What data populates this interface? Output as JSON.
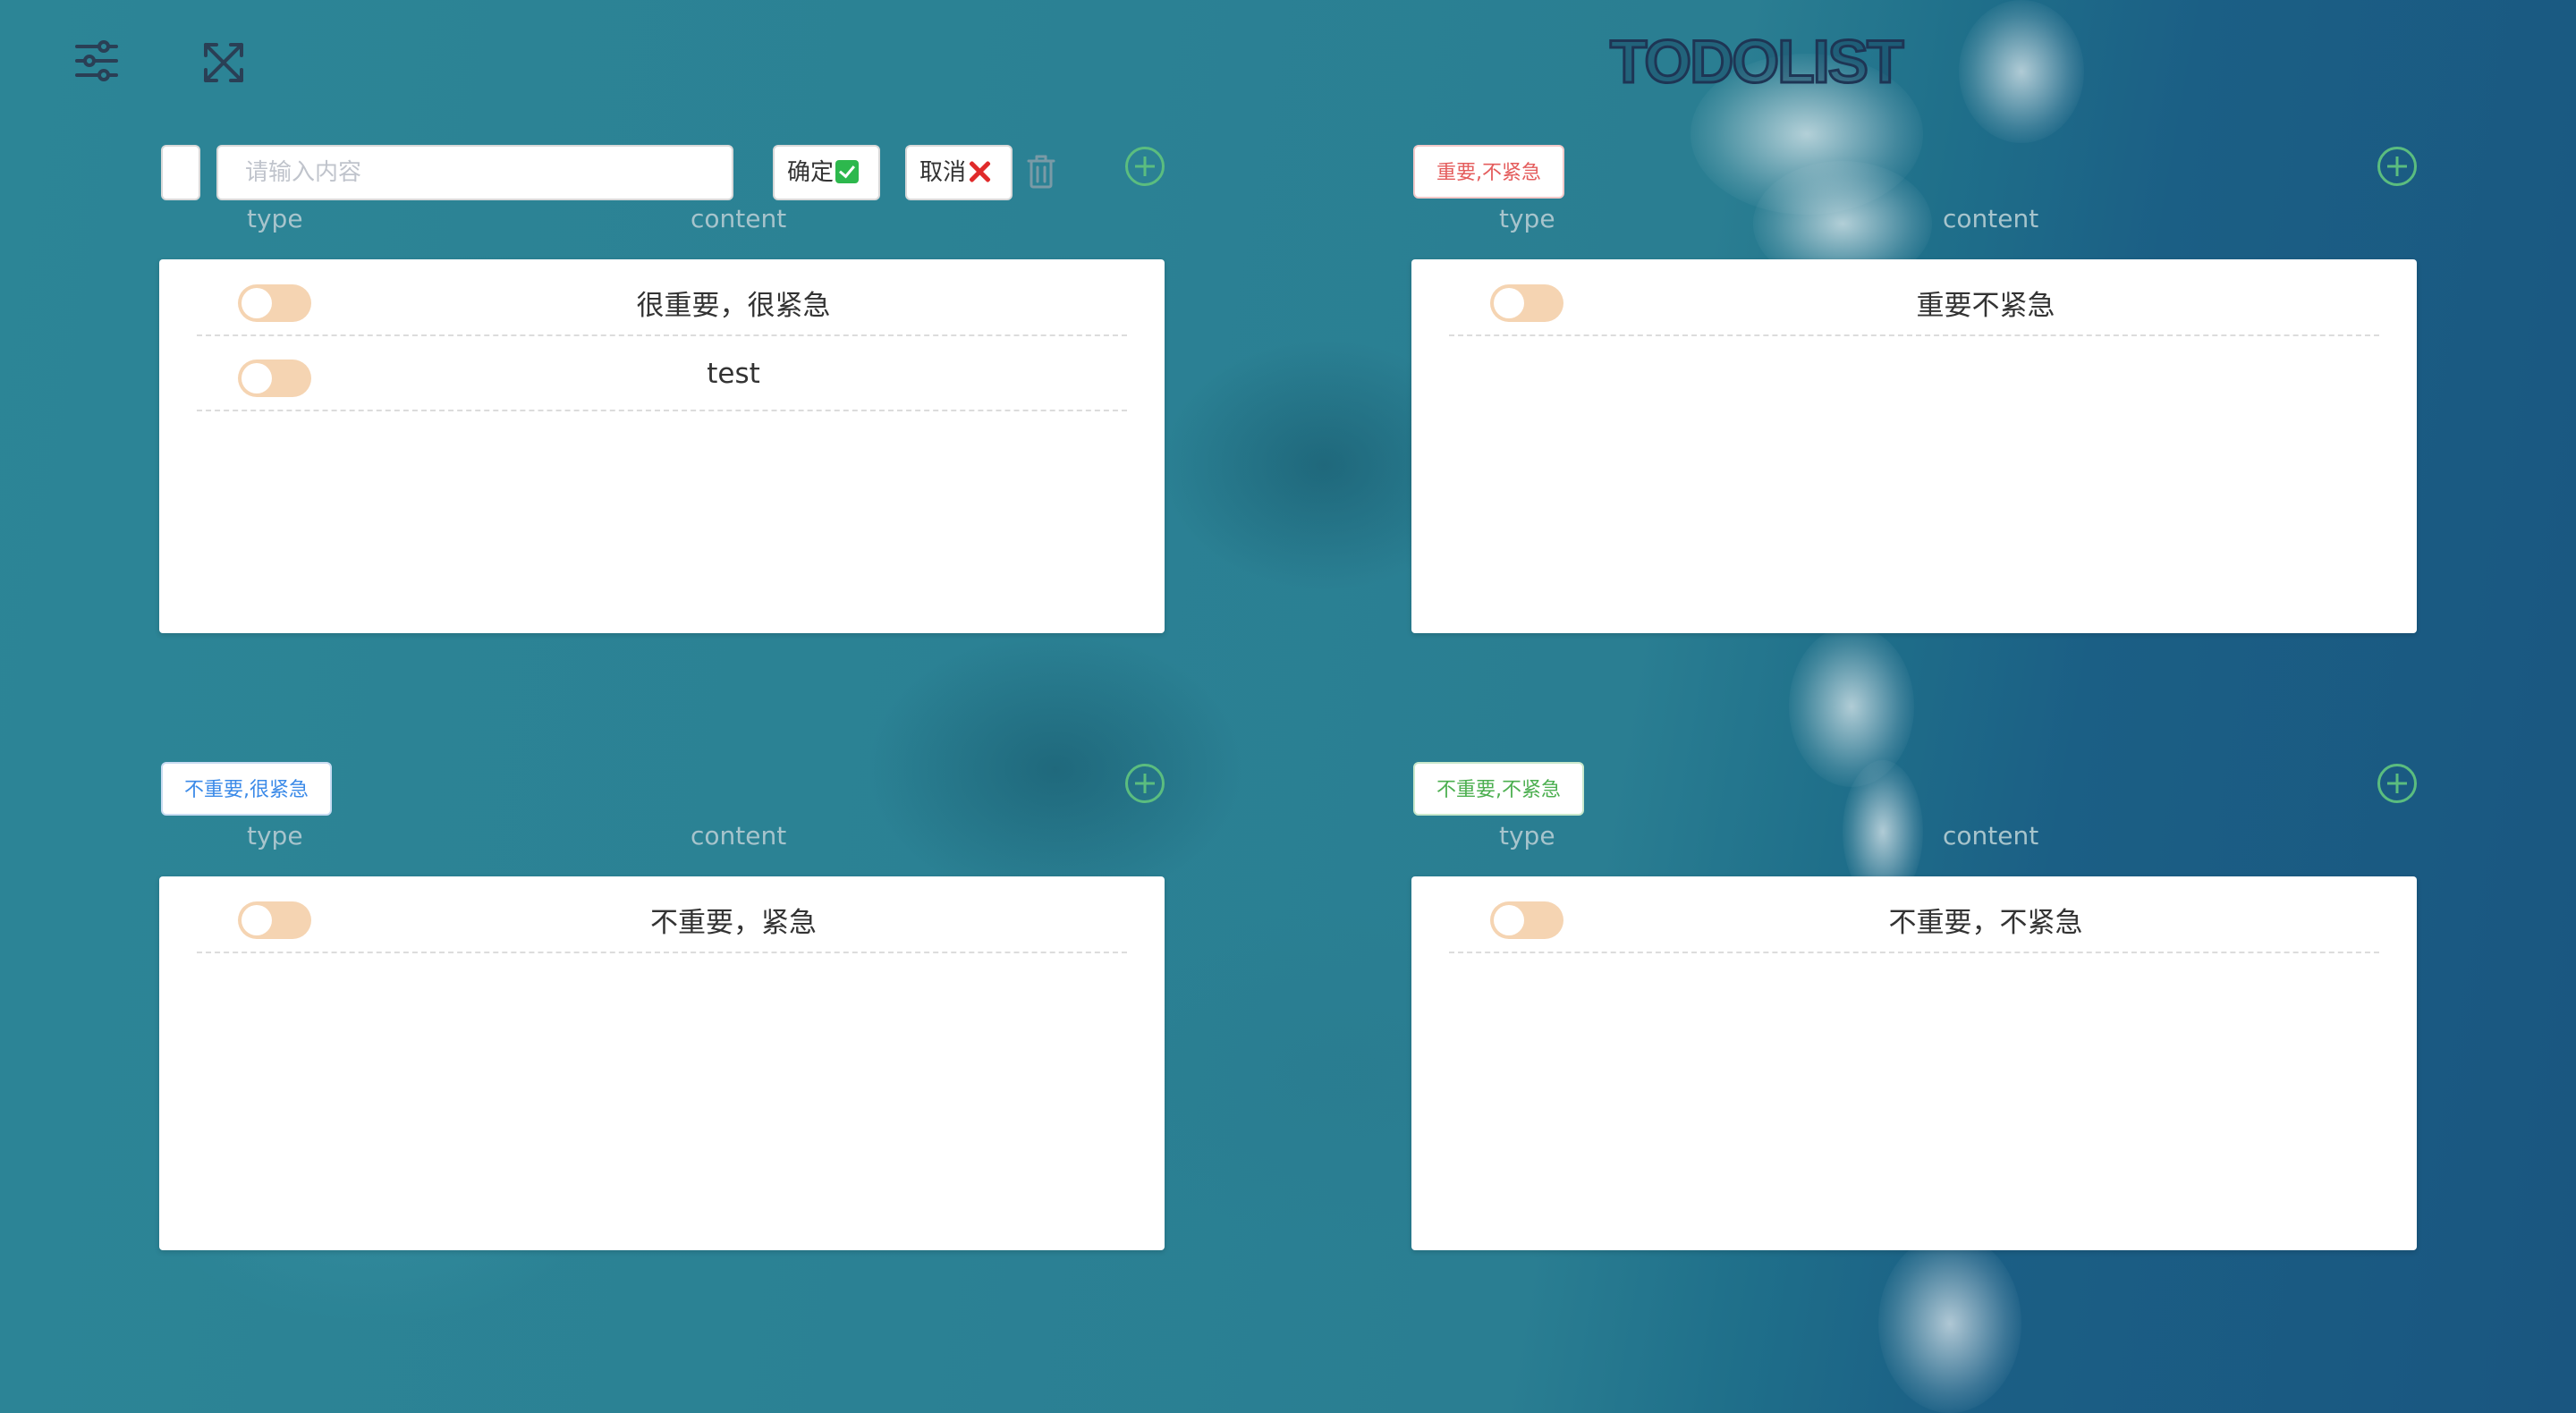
{
  "app": {
    "title": "TODOLIST"
  },
  "toolbar": {
    "settings_icon": "sliders-icon",
    "fullscreen_icon": "expand-icon"
  },
  "headers": {
    "type": "type",
    "content": "content"
  },
  "editor": {
    "input_placeholder": "请输入内容",
    "input_value": "",
    "confirm_label": "确定",
    "cancel_label": "取消",
    "confirm_icon": "check-icon",
    "cancel_icon": "x-icon",
    "delete_icon": "trash-icon"
  },
  "quadrants": [
    {
      "type_label": "",
      "items": [
        {
          "text": "很重要，很紧急",
          "done": false
        },
        {
          "text": "test",
          "done": false
        }
      ]
    },
    {
      "type_label": "重要,不紧急",
      "type_color": "#e45c5c",
      "items": [
        {
          "text": "重要不紧急",
          "done": false
        }
      ]
    },
    {
      "type_label": "不重要,很紧急",
      "type_color": "#3b8ae8",
      "items": [
        {
          "text": "不重要，紧急",
          "done": false
        }
      ]
    },
    {
      "type_label": "不重要,不紧急",
      "type_color": "#4caf50",
      "items": [
        {
          "text": "不重要，不紧急",
          "done": false
        }
      ]
    }
  ],
  "colors": {
    "toggle_off": "#f5d4b2",
    "add_button": "#5bbd7f",
    "title_stroke": "#1e3554"
  }
}
